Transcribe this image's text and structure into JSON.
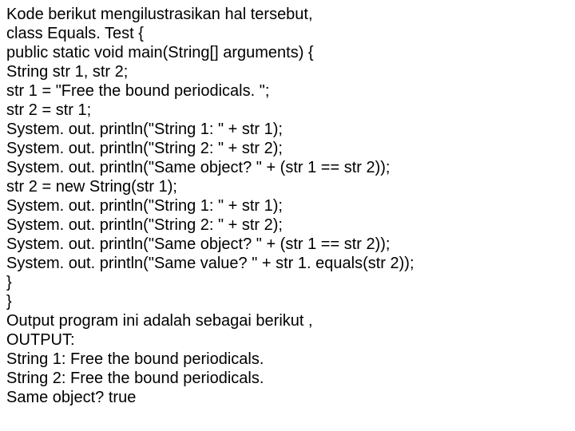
{
  "lines": [
    "Kode berikut mengilustrasikan hal tersebut,",
    "class Equals. Test {",
    "public static void main(String[] arguments) {",
    "String str 1, str 2;",
    "str 1 = \"Free the bound periodicals. \";",
    "str 2 = str 1;",
    "System. out. println(\"String 1: \" + str 1);",
    "System. out. println(\"String 2: \" + str 2);",
    "System. out. println(\"Same object? \" + (str 1 == str 2));",
    "str 2 = new String(str 1);",
    "System. out. println(\"String 1: \" + str 1);",
    "System. out. println(\"String 2: \" + str 2);",
    "System. out. println(\"Same object? \" + (str 1 == str 2));",
    "System. out. println(\"Same value? \" + str 1. equals(str 2));",
    "}",
    "}",
    "Output program ini adalah sebagai berikut ,",
    "OUTPUT:",
    "String 1: Free the bound periodicals.",
    "String 2: Free the bound periodicals.",
    "Same object? true"
  ]
}
